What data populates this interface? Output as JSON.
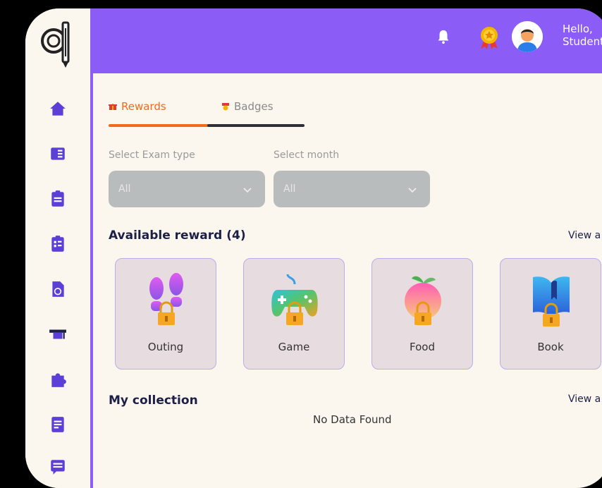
{
  "header": {
    "greeting_line1": "Hello,",
    "greeting_line2": "Student",
    "icons": [
      "bell-icon",
      "medal-icon",
      "avatar",
      "chevron-down-icon"
    ],
    "bg_color": "#8b5cf6"
  },
  "sidebar": {
    "icons": [
      "home-icon",
      "book-icon",
      "clipboard-icon",
      "clipboard-list-icon",
      "document-icon",
      "graduation-cap-icon",
      "puzzle-icon",
      "notes-icon",
      "chat-icon"
    ]
  },
  "tabs": [
    {
      "label": "Rewards",
      "active": true,
      "color": "#f26b1d"
    },
    {
      "label": "Badges",
      "active": false
    }
  ],
  "filters": {
    "exam_type": {
      "label": "Select Exam type",
      "value": "All"
    },
    "month": {
      "label": "Select month",
      "value": "All"
    }
  },
  "available_reward": {
    "title": "Available reward (4)",
    "view_all": "View a",
    "items": [
      {
        "label": "Outing",
        "icon": "footprints-locked-icon"
      },
      {
        "label": "Game",
        "icon": "gamepad-locked-icon"
      },
      {
        "label": "Food",
        "icon": "fruit-locked-icon"
      },
      {
        "label": "Book",
        "icon": "book-locked-icon"
      }
    ]
  },
  "my_collection": {
    "title": "My collection",
    "view_all": "View a",
    "empty_text": "No Data Found"
  }
}
